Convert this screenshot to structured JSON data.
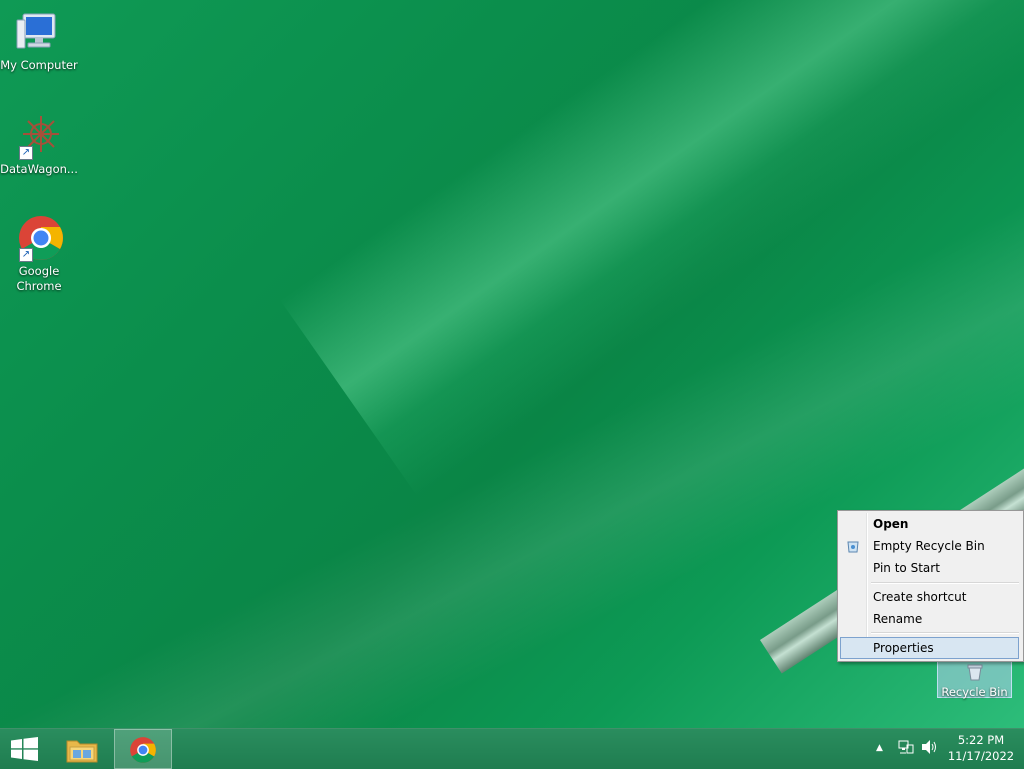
{
  "desktop": {
    "icons": [
      {
        "label": "My Computer",
        "icon": "computer-icon"
      },
      {
        "label": "DataWagon...",
        "icon": "datawagon-icon"
      },
      {
        "label_line1": "Google",
        "label_line2": "Chrome",
        "icon": "chrome-icon"
      }
    ],
    "recycle_bin": {
      "label": "Recycle Bin",
      "icon": "recycle-bin-icon"
    }
  },
  "context_menu": {
    "items": [
      {
        "label": "Open",
        "bold": true
      },
      {
        "label": "Empty Recycle Bin",
        "icon": "recycle-bin-small-icon"
      },
      {
        "label": "Pin to Start"
      },
      {
        "label": "Create shortcut"
      },
      {
        "label": "Rename"
      },
      {
        "label": "Properties",
        "highlighted": true
      }
    ]
  },
  "taskbar": {
    "start_icon": "windows-logo-icon",
    "pinned": [
      {
        "name": "file-explorer",
        "icon": "folder-icon"
      },
      {
        "name": "google-chrome",
        "icon": "chrome-icon",
        "active": true
      }
    ],
    "tray": {
      "overflow_icon": "up-arrow-icon",
      "network_icon": "network-icon",
      "volume_icon": "speaker-icon",
      "time": "5:22 PM",
      "date": "11/17/2022"
    }
  },
  "colors": {
    "wallpaper": "#0b8e4c",
    "taskbar": "#1f7d50",
    "menu_bg": "#f0f0f0",
    "menu_highlight": "#d8e6f2"
  }
}
